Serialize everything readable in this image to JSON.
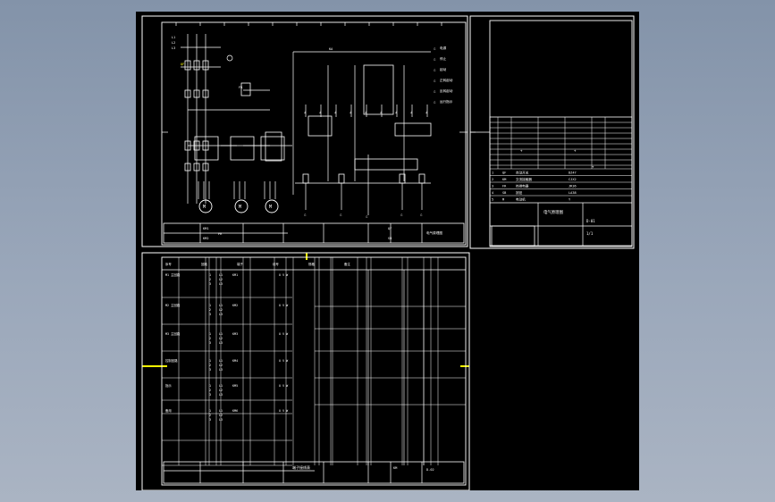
{
  "viewport": {
    "background": "#94a2b6"
  },
  "sheet": {
    "background": "#000000",
    "line_color": "#ffffff",
    "accent": "#ffff00"
  },
  "schematic_labels": [
    "L1",
    "L2",
    "L3",
    "QF",
    "KM1",
    "KM2",
    "FR",
    "M1",
    "M2",
    "M3",
    "SB1",
    "SB2",
    "SB3",
    "KA"
  ],
  "legend_labels": [
    "电源",
    "停止",
    "起动",
    "正转起动",
    "反转起动",
    "运行指示"
  ],
  "bom_rows": [
    [
      "1",
      "QF",
      "自动开关",
      "DZ47"
    ],
    [
      "2",
      "KM",
      "交流接触器",
      "CJX2"
    ],
    [
      "3",
      "FR",
      "热继电器",
      "JR36"
    ],
    [
      "4",
      "SB",
      "按钮",
      "LA38"
    ],
    [
      "5",
      "M",
      "电动机",
      "Y"
    ]
  ],
  "title_block": {
    "drawing_name": "电气原理图",
    "drawing_no": "D-01",
    "sheet": "1/1"
  },
  "table_blocks": [
    {
      "name": "M1 主回路"
    },
    {
      "name": "M2 主回路"
    },
    {
      "name": "M3 主回路"
    },
    {
      "name": "控制回路"
    },
    {
      "name": "指示"
    },
    {
      "name": "备用"
    }
  ]
}
